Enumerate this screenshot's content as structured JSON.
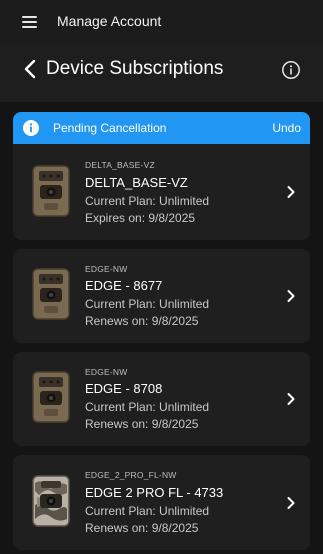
{
  "topbar": {
    "title": "Manage Account"
  },
  "header": {
    "title": "Device Subscriptions"
  },
  "banner": {
    "text": "Pending Cancellation",
    "action": "Undo",
    "color": "#2196f3"
  },
  "devices": [
    {
      "model": "DELTA_BASE-VZ",
      "name": "DELTA_BASE-VZ",
      "plan": "Current Plan: Unlimited",
      "date": "Expires on: 9/8/2025",
      "camo": false
    },
    {
      "model": "EDGE-NW",
      "name": "EDGE - 8677",
      "plan": "Current Plan: Unlimited",
      "date": "Renews on: 9/8/2025",
      "camo": false
    },
    {
      "model": "EDGE-NW",
      "name": "EDGE - 8708",
      "plan": "Current Plan: Unlimited",
      "date": "Renews on: 9/8/2025",
      "camo": false
    },
    {
      "model": "EDGE_2_PRO_FL-NW",
      "name": "EDGE 2 PRO FL - 4733",
      "plan": "Current Plan: Unlimited",
      "date": "Renews on: 9/8/2025",
      "camo": true
    }
  ],
  "icons": {
    "menu": "hamburger-menu-icon",
    "back": "chevron-left-icon",
    "info": "info-circle-icon",
    "device": "trail-camera-icon",
    "open": "chevron-right-icon"
  }
}
